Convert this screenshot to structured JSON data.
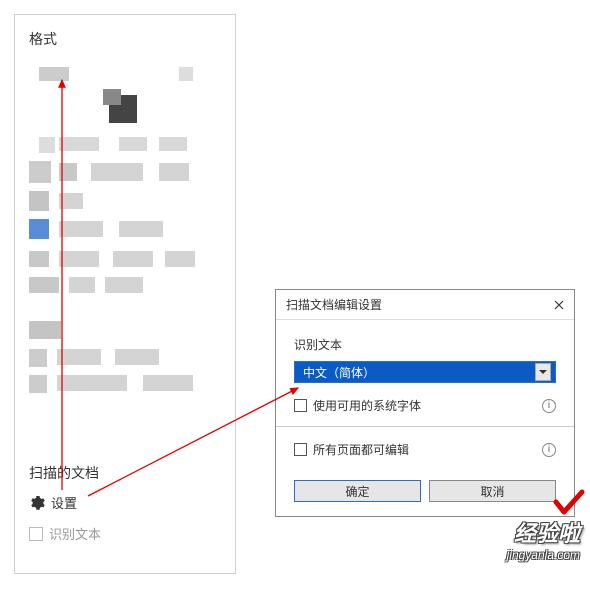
{
  "left_panel": {
    "title": "格式",
    "section_title": "扫描的文档",
    "settings_label": "设置",
    "recognize_text": "识别文本"
  },
  "dialog": {
    "title": "扫描文档编辑设置",
    "recognize_label": "识别文本",
    "language_selected": "中文（简体）",
    "use_system_font": "使用可用的系统字体",
    "all_pages_editable": "所有页面都可编辑",
    "ok": "确定",
    "cancel": "取消"
  },
  "watermark": {
    "main": "经验啦",
    "sub": "jingyanla.com"
  }
}
